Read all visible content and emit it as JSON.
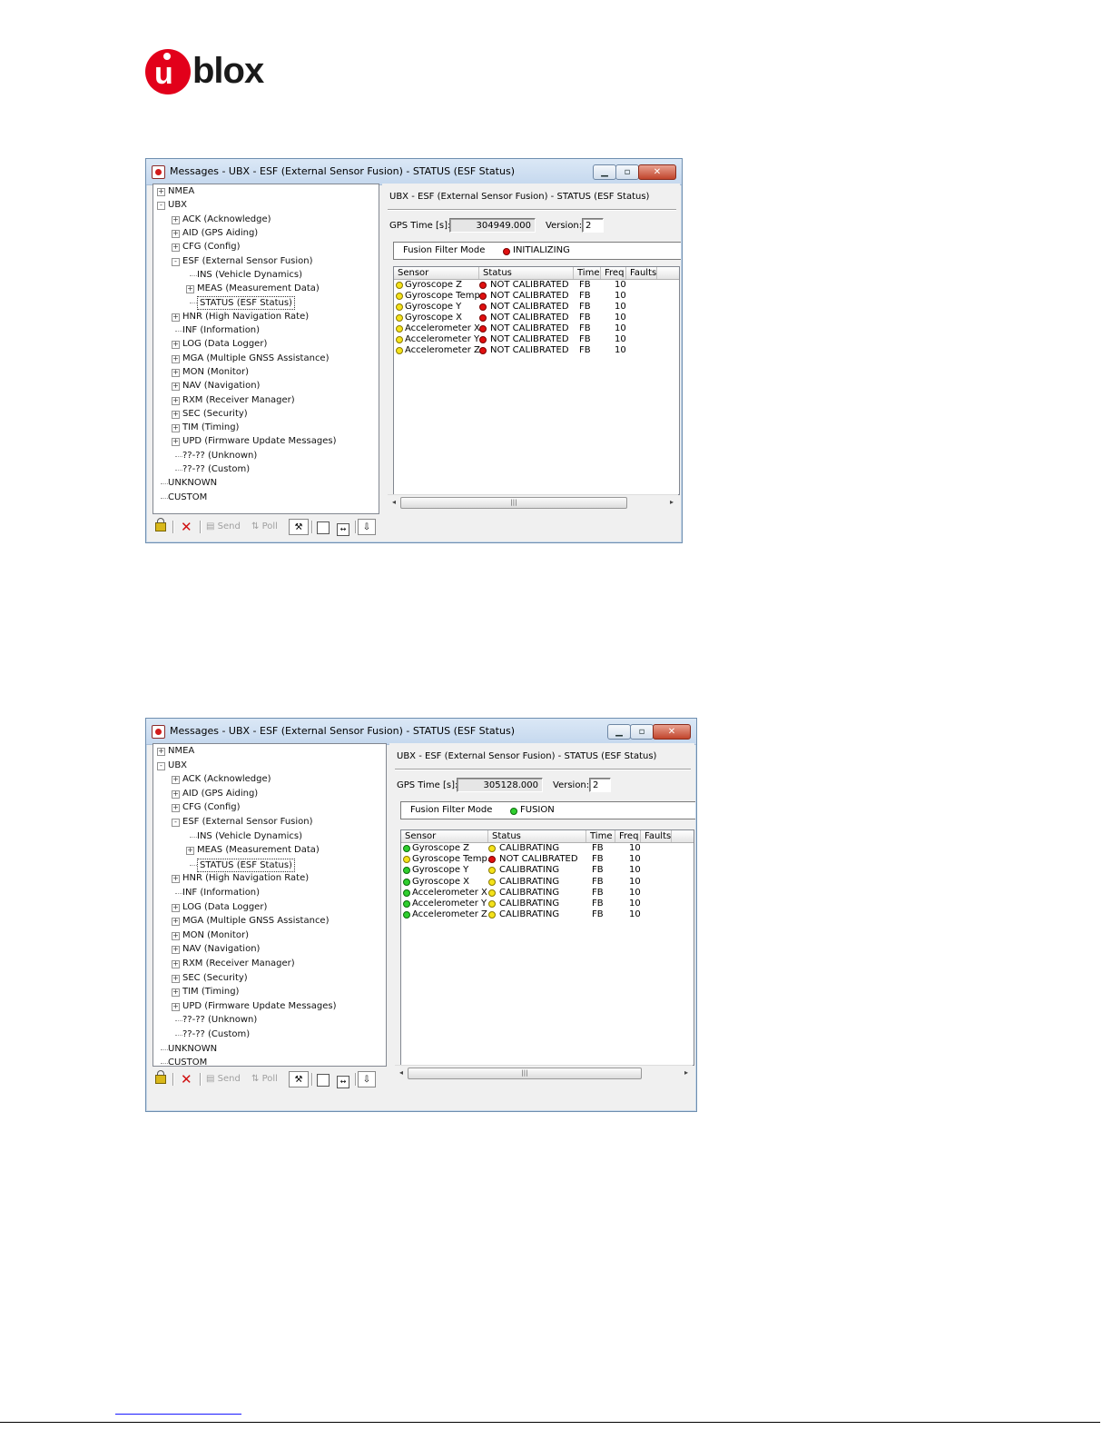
{
  "logo": {
    "text": "blox",
    "initial": "u"
  },
  "screens": [
    {
      "title": "Messages - UBX - ESF (External Sensor Fusion) - STATUS (ESF Status)",
      "tree": {
        "root1": "NMEA",
        "root2": "UBX",
        "items": [
          "ACK (Acknowledge)",
          "AID (GPS Aiding)",
          "CFG (Config)",
          "ESF (External Sensor Fusion)",
          "INS (Vehicle Dynamics)",
          "MEAS (Measurement Data)",
          "STATUS (ESF Status)",
          "HNR (High Navigation Rate)",
          "INF (Information)",
          "LOG (Data Logger)",
          "MGA (Multiple GNSS Assistance)",
          "MON (Monitor)",
          "NAV (Navigation)",
          "RXM (Receiver Manager)",
          "SEC (Security)",
          "TIM (Timing)",
          "UPD (Firmware Update Messages)",
          "??-?? (Unknown)",
          "??-?? (Custom)"
        ],
        "root3": "UNKNOWN",
        "root4": "CUSTOM"
      },
      "panel_header": "UBX - ESF (External Sensor Fusion) - STATUS (ESF Status)",
      "gps_time_label": "GPS Time [s]:",
      "gps_time": "304949.000",
      "version_label": "Version:",
      "version": "2",
      "fusion_label": "Fusion Filter Mode",
      "fusion_value": "INITIALIZING",
      "fusion_color": "red",
      "columns": [
        "Sensor",
        "Status",
        "Time",
        "Freq",
        "Faults"
      ],
      "rows": [
        {
          "sensor": "Gyroscope Z",
          "sensor_color": "yellow",
          "status": "NOT CALIBRATED",
          "status_color": "red",
          "time": "FB",
          "freq": "10"
        },
        {
          "sensor": "Gyroscope Temp.",
          "sensor_color": "yellow",
          "status": "NOT CALIBRATED",
          "status_color": "red",
          "time": "FB",
          "freq": "10"
        },
        {
          "sensor": "Gyroscope Y",
          "sensor_color": "yellow",
          "status": "NOT CALIBRATED",
          "status_color": "red",
          "time": "FB",
          "freq": "10"
        },
        {
          "sensor": "Gyroscope X",
          "sensor_color": "yellow",
          "status": "NOT CALIBRATED",
          "status_color": "red",
          "time": "FB",
          "freq": "10"
        },
        {
          "sensor": "Accelerometer X",
          "sensor_color": "yellow",
          "status": "NOT CALIBRATED",
          "status_color": "red",
          "time": "FB",
          "freq": "10"
        },
        {
          "sensor": "Accelerometer Y",
          "sensor_color": "yellow",
          "status": "NOT CALIBRATED",
          "status_color": "red",
          "time": "FB",
          "freq": "10"
        },
        {
          "sensor": "Accelerometer Z",
          "sensor_color": "yellow",
          "status": "NOT CALIBRATED",
          "status_color": "red",
          "time": "FB",
          "freq": "10"
        }
      ],
      "toolbar": {
        "send": "Send",
        "poll": "Poll"
      }
    },
    {
      "title": "Messages - UBX - ESF (External Sensor Fusion) - STATUS (ESF Status)",
      "tree": {
        "root1": "NMEA",
        "root2": "UBX",
        "items": [
          "ACK (Acknowledge)",
          "AID (GPS Aiding)",
          "CFG (Config)",
          "ESF (External Sensor Fusion)",
          "INS (Vehicle Dynamics)",
          "MEAS (Measurement Data)",
          "STATUS (ESF Status)",
          "HNR (High Navigation Rate)",
          "INF (Information)",
          "LOG (Data Logger)",
          "MGA (Multiple GNSS Assistance)",
          "MON (Monitor)",
          "NAV (Navigation)",
          "RXM (Receiver Manager)",
          "SEC (Security)",
          "TIM (Timing)",
          "UPD (Firmware Update Messages)",
          "??-?? (Unknown)",
          "??-?? (Custom)"
        ],
        "root3": "UNKNOWN",
        "root4": "CUSTOM"
      },
      "panel_header": "UBX - ESF (External Sensor Fusion) - STATUS (ESF Status)",
      "gps_time_label": "GPS Time [s]:",
      "gps_time": "305128.000",
      "version_label": "Version:",
      "version": "2",
      "fusion_label": "Fusion Filter Mode",
      "fusion_value": "FUSION",
      "fusion_color": "green",
      "columns": [
        "Sensor",
        "Status",
        "Time",
        "Freq",
        "Faults"
      ],
      "rows": [
        {
          "sensor": "Gyroscope Z",
          "sensor_color": "green",
          "status": "CALIBRATING",
          "status_color": "yellow",
          "time": "FB",
          "freq": "10"
        },
        {
          "sensor": "Gyroscope Temp.",
          "sensor_color": "yellow",
          "status": "NOT CALIBRATED",
          "status_color": "red",
          "time": "FB",
          "freq": "10"
        },
        {
          "sensor": "Gyroscope Y",
          "sensor_color": "green",
          "status": "CALIBRATING",
          "status_color": "yellow",
          "time": "FB",
          "freq": "10"
        },
        {
          "sensor": "Gyroscope X",
          "sensor_color": "green",
          "status": "CALIBRATING",
          "status_color": "yellow",
          "time": "FB",
          "freq": "10"
        },
        {
          "sensor": "Accelerometer X",
          "sensor_color": "green",
          "status": "CALIBRATING",
          "status_color": "yellow",
          "time": "FB",
          "freq": "10"
        },
        {
          "sensor": "Accelerometer Y",
          "sensor_color": "green",
          "status": "CALIBRATING",
          "status_color": "yellow",
          "time": "FB",
          "freq": "10"
        },
        {
          "sensor": "Accelerometer Z",
          "sensor_color": "green",
          "status": "CALIBRATING",
          "status_color": "yellow",
          "time": "FB",
          "freq": "10"
        }
      ],
      "toolbar": {
        "send": "Send",
        "poll": "Poll"
      }
    }
  ]
}
